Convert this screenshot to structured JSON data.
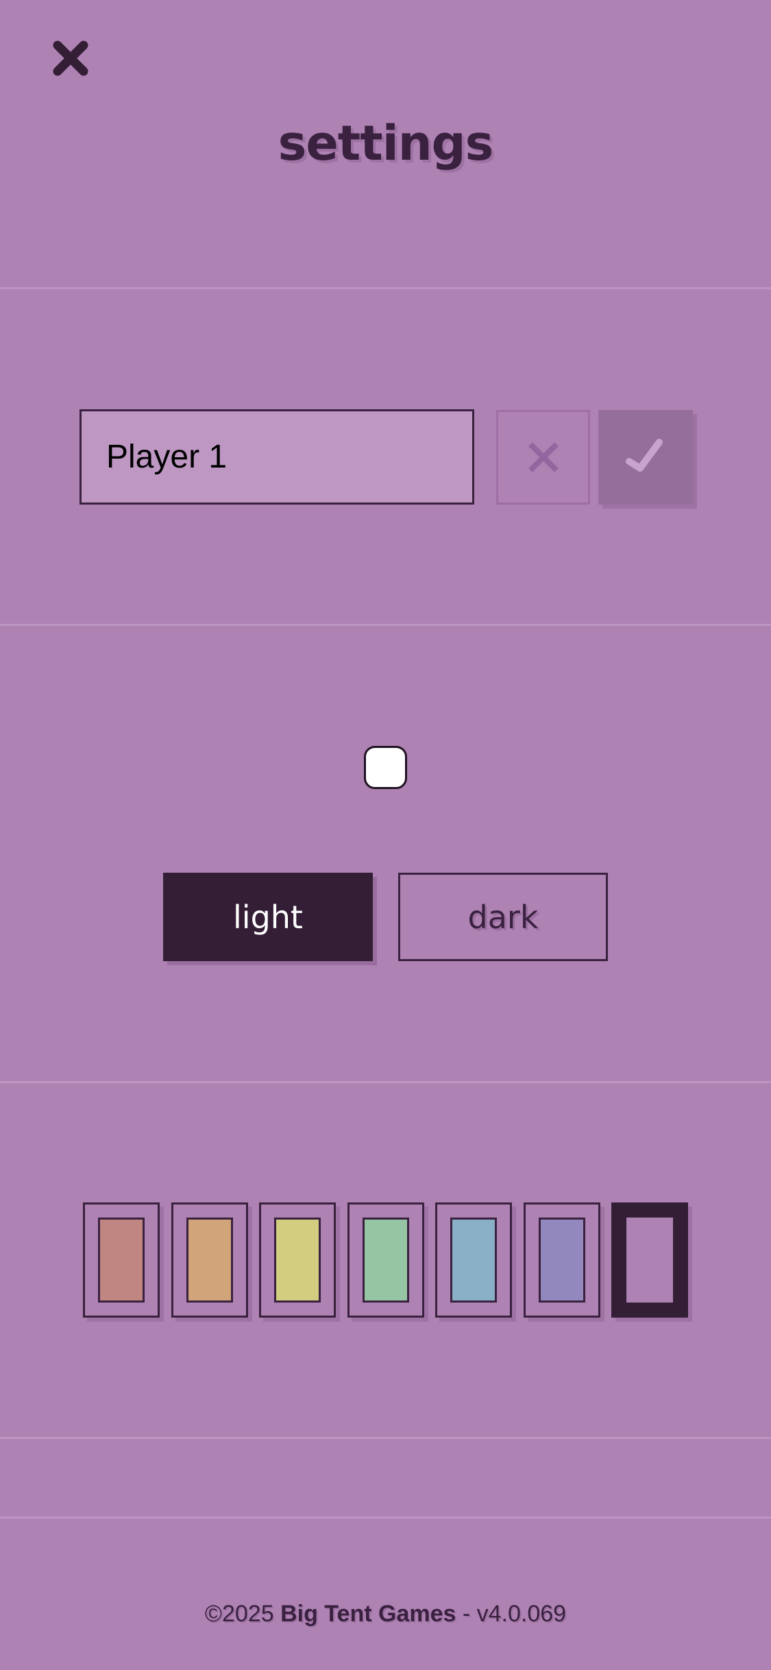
{
  "header": {
    "title": "settings",
    "close_icon": "close-icon"
  },
  "name_section": {
    "input_value": "Player 1",
    "cancel_icon": "x-icon",
    "confirm_icon": "checkmark-icon"
  },
  "appearance": {
    "avatar_color": "#ffffff",
    "theme_options": [
      "light",
      "dark"
    ],
    "selected_theme": "light"
  },
  "colors": {
    "swatches": [
      {
        "name": "red",
        "color": "#c08682",
        "selected": false
      },
      {
        "name": "orange",
        "color": "#d1a579",
        "selected": false
      },
      {
        "name": "yellow",
        "color": "#d3cd7f",
        "selected": false
      },
      {
        "name": "green",
        "color": "#95c5a3",
        "selected": false
      },
      {
        "name": "blue",
        "color": "#8ab0c8",
        "selected": false
      },
      {
        "name": "purple",
        "color": "#9388bd",
        "selected": false
      },
      {
        "name": "pink",
        "color": "#ae82b3",
        "selected": true
      }
    ]
  },
  "footer": {
    "copyright": "©2025",
    "company": "Big Tent Games",
    "version": "- v4.0.069"
  },
  "palette": {
    "background": "#ae82b3",
    "accent_dark": "#331e35"
  }
}
